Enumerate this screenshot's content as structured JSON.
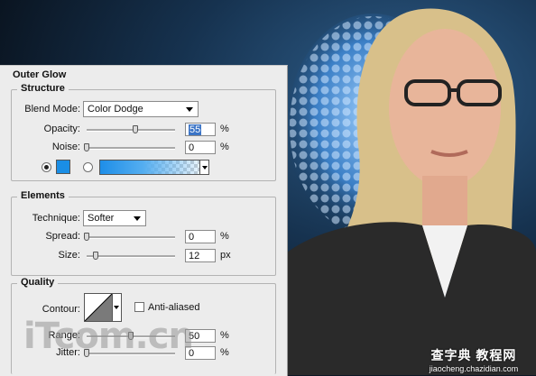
{
  "colors": {
    "panel_bg": "#ececec",
    "glow_color": "#1a8ee6",
    "selection": "#3b74c6"
  },
  "dialog": {
    "title": "Outer Glow",
    "structure": {
      "title": "Structure",
      "blend_mode_label": "Blend Mode:",
      "blend_mode_value": "Color Dodge",
      "opacity_label": "Opacity:",
      "opacity_value": "55",
      "opacity_slider_percent": 55,
      "opacity_unit": "%",
      "noise_label": "Noise:",
      "noise_value": "0",
      "noise_slider_percent": 0,
      "noise_unit": "%",
      "color_radio_selected": true,
      "gradient_radio_selected": false
    },
    "elements": {
      "title": "Elements",
      "technique_label": "Technique:",
      "technique_value": "Softer",
      "spread_label": "Spread:",
      "spread_value": "0",
      "spread_unit": "%",
      "size_label": "Size:",
      "size_value": "12",
      "size_unit": "px"
    },
    "quality": {
      "title": "Quality",
      "contour_label": "Contour:",
      "anti_aliased_label": "Anti-aliased",
      "anti_aliased_checked": false,
      "range_label": "Range:",
      "range_value": "50",
      "range_unit": "%",
      "jitter_label": "Jitter:",
      "jitter_value": "0",
      "jitter_unit": "%"
    }
  },
  "watermarks": {
    "left": "iTcom.cn",
    "site_cn": "查字典 教程网",
    "site_url": "jiaocheng.chazidian.com"
  }
}
